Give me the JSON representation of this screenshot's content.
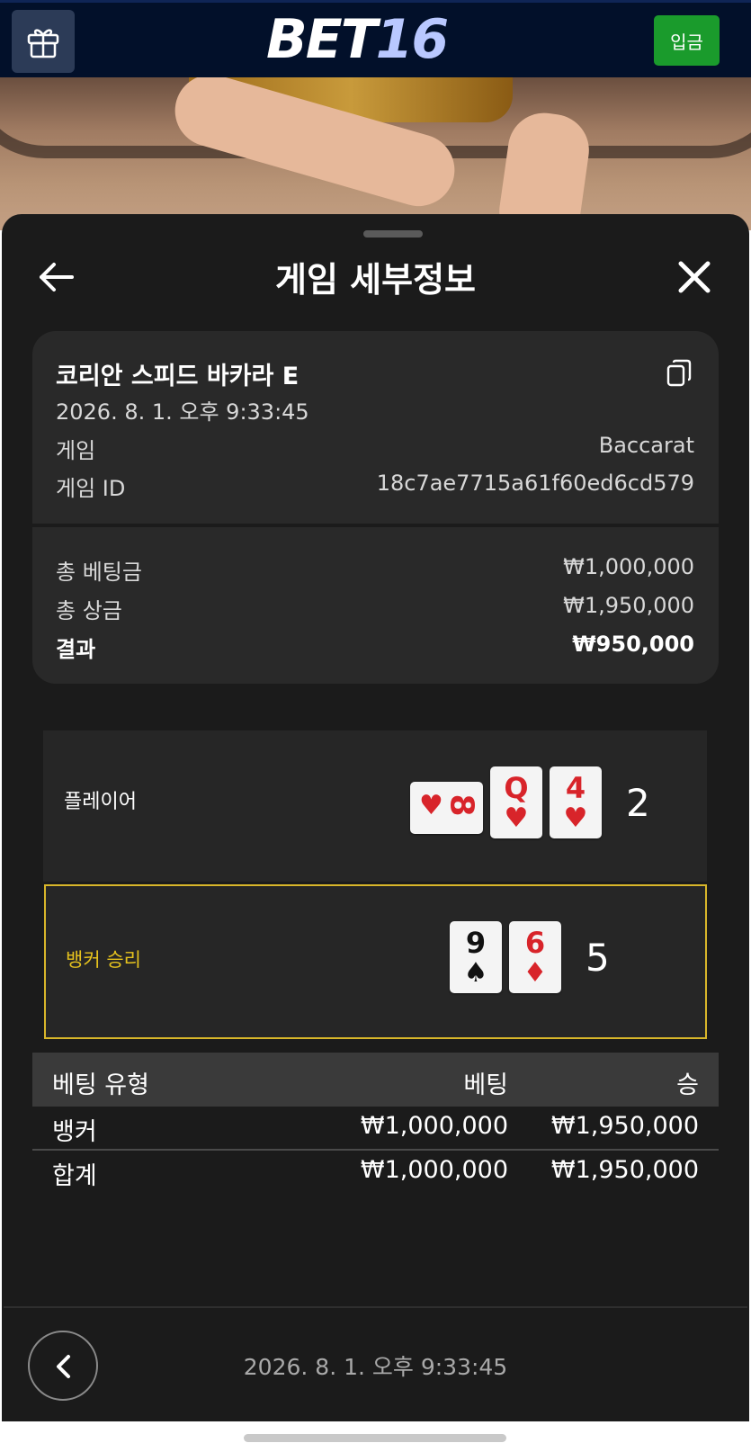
{
  "header": {
    "logo_part1": "BET",
    "logo_part2": "16",
    "deposit_label": "입금",
    "gift_icon": "gift-icon"
  },
  "sheet": {
    "title": "게임 세부정보",
    "back_icon": "arrow-left-icon",
    "close_icon": "close-icon"
  },
  "game_info": {
    "name": "코리안 스피드 바카라 E",
    "datetime": "2026. 8. 1. 오후 9:33:45",
    "game_label": "게임",
    "game_value": "Baccarat",
    "id_label": "게임 ID",
    "id_value": "18c7ae7715a61f60ed6cd579",
    "copy_icon": "copy-icon"
  },
  "totals": {
    "total_bet_label": "총 베팅금",
    "total_bet_value": "₩1,000,000",
    "total_win_label": "총 상금",
    "total_win_value": "₩1,950,000",
    "result_label": "결과",
    "result_value": "₩950,000"
  },
  "hands": {
    "player": {
      "label": "플레이어",
      "score": "2",
      "cards": [
        {
          "rank": "8",
          "suit": "♥",
          "color": "red",
          "rotated": true
        },
        {
          "rank": "Q",
          "suit": "♥",
          "color": "red"
        },
        {
          "rank": "4",
          "suit": "♥",
          "color": "red"
        }
      ]
    },
    "banker": {
      "label": "뱅커 승리",
      "label_color": "#e5c21e",
      "score": "5",
      "cards": [
        {
          "rank": "9",
          "suit": "♠",
          "color": "black"
        },
        {
          "rank": "6",
          "suit": "♦",
          "color": "red"
        }
      ]
    }
  },
  "bets_table": {
    "headers": [
      "베팅 유형",
      "베팅",
      "승"
    ],
    "rows": [
      {
        "type": "뱅커",
        "bet": "₩1,000,000",
        "win": "₩1,950,000"
      }
    ],
    "total": {
      "type": "합계",
      "bet": "₩1,000,000",
      "win": "₩1,950,000"
    }
  },
  "footer": {
    "back_icon": "chevron-left-icon",
    "datetime": "2026. 8. 1. 오후 9:33:45"
  },
  "colors": {
    "header_bg": "#02102a",
    "deposit_green": "#1a9b2c",
    "sheet_bg": "#1b1b1b",
    "card_bg": "#292929",
    "banker_highlight": "#d8b62a",
    "suit_red": "#d8242a"
  }
}
